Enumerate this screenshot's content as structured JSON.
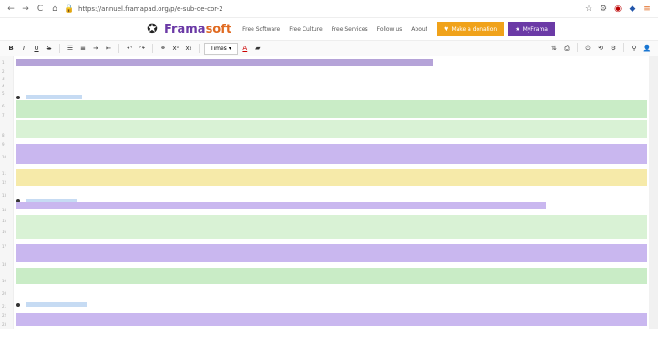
{
  "browser": {
    "url": "https://annuel.framapad.org/p/e-sub-de-cor-2",
    "back_label": "←",
    "forward_label": "→",
    "reload_label": "C"
  },
  "framabar": {
    "brand_frama": "Frama",
    "brand_soft": "soft",
    "nav": [
      "Free Software",
      "Free Culture",
      "Free Services",
      "Follow us",
      "About"
    ],
    "support_label": "Make a donation",
    "mystuff_label": "MyFrama"
  },
  "toolbar": {
    "bold": "B",
    "italic": "I",
    "underline": "U",
    "strike": "S",
    "font_select": "Times"
  },
  "doc": {
    "line_numbers": [
      "1",
      "2",
      "3",
      "4",
      "5",
      "6",
      "7",
      "8",
      "9",
      "10",
      "11",
      "12",
      "13",
      "14",
      "15",
      "16",
      "17",
      "18",
      "19",
      "20",
      "21",
      "22",
      "23"
    ],
    "headings": [
      "Lamar y temas con ustes",
      "Lleiado aragonia",
      "Lecho de la atencion bro"
    ]
  },
  "colors": {
    "purple": "#6b3aa6",
    "orange": "#e06a21",
    "support": "#f0a21a"
  }
}
